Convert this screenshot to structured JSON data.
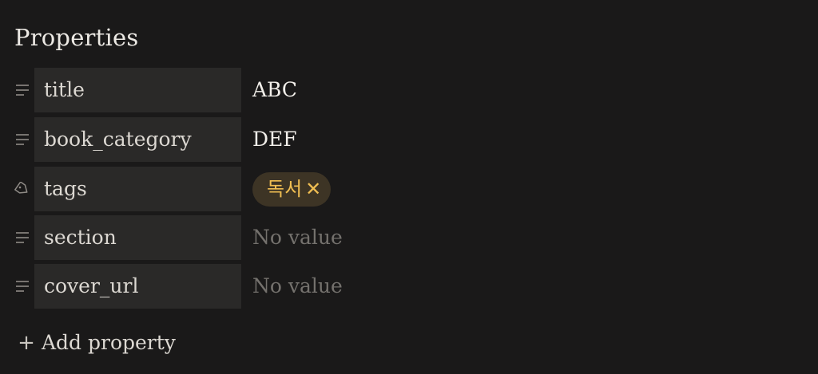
{
  "panel": {
    "heading": "Properties"
  },
  "properties": [
    {
      "key": "title",
      "value": "ABC",
      "type_icon": "text-lines-icon"
    },
    {
      "key": "book_category",
      "value": "DEF",
      "type_icon": "text-lines-icon"
    },
    {
      "key": "tags",
      "tags": [
        {
          "label": "독서",
          "remove_glyph": "✕"
        }
      ],
      "type_icon": "tag-icon"
    },
    {
      "key": "section",
      "value": "No value",
      "type_icon": "text-lines-icon"
    },
    {
      "key": "cover_url",
      "value": "No value",
      "type_icon": "text-lines-icon"
    }
  ],
  "add_property": {
    "icon": "+",
    "label": "Add property"
  },
  "colors": {
    "background": "#1a1919",
    "key_cell": "#2a2928",
    "tag_background": "#3d3425",
    "tag_text": "#f0be52",
    "empty_value": "#74716d"
  }
}
